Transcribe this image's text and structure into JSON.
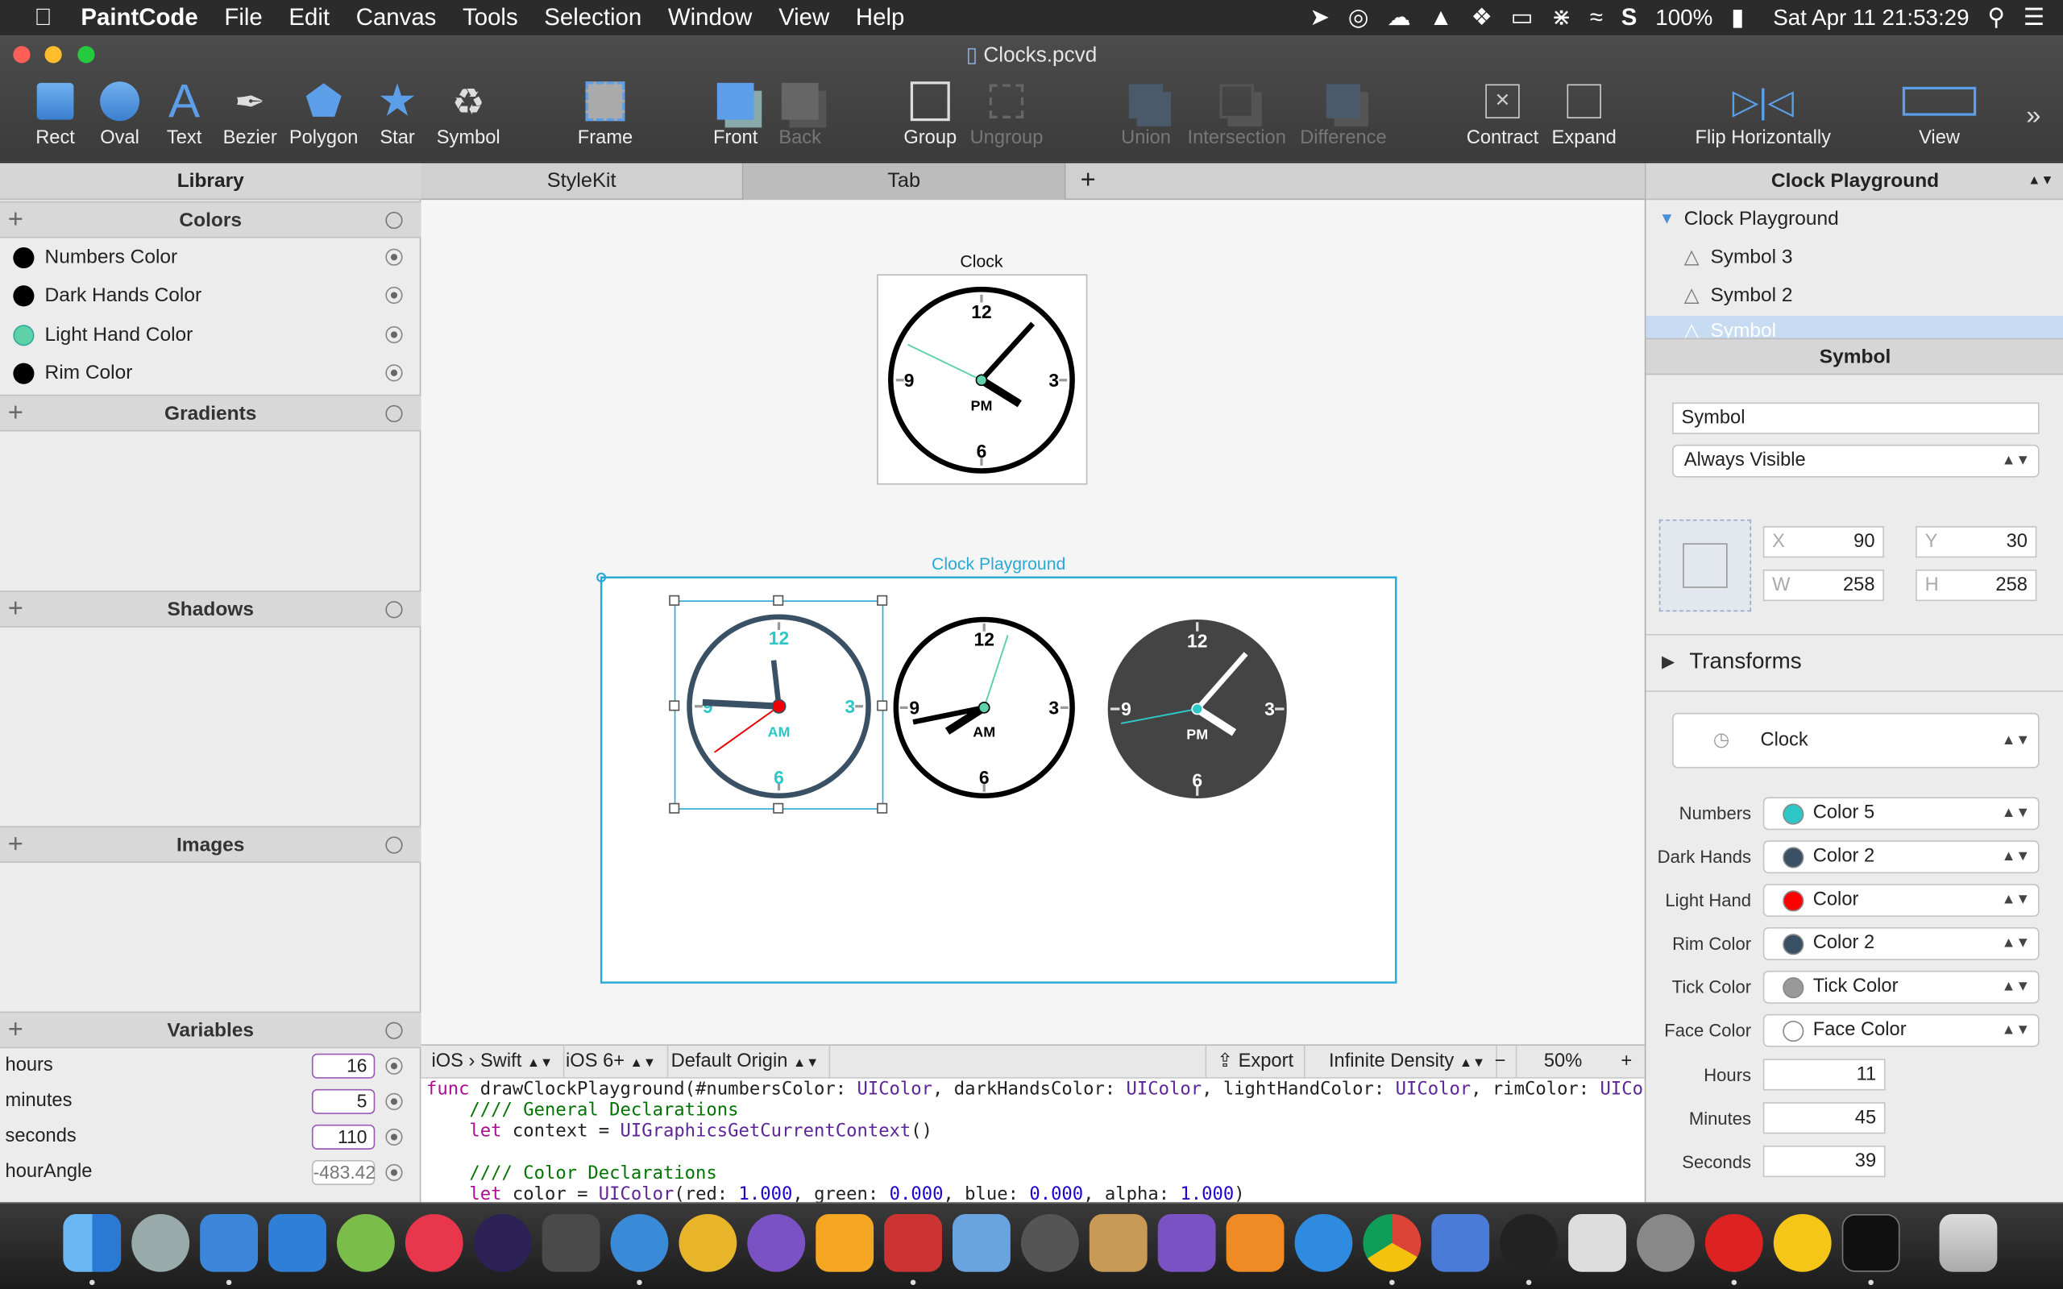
{
  "menubar": {
    "app": "PaintCode",
    "items": [
      "File",
      "Edit",
      "Canvas",
      "Tools",
      "Selection",
      "Window",
      "View",
      "Help"
    ],
    "battery": "100%",
    "clock": "Sat Apr 11  21:53:29"
  },
  "window": {
    "title": "Clocks.pcvd"
  },
  "toolbar": {
    "rect": "Rect",
    "oval": "Oval",
    "text": "Text",
    "bezier": "Bezier",
    "polygon": "Polygon",
    "star": "Star",
    "symbol": "Symbol",
    "frame": "Frame",
    "front": "Front",
    "back": "Back",
    "group": "Group",
    "ungroup": "Ungroup",
    "union": "Union",
    "intersection": "Intersection",
    "difference": "Difference",
    "contract": "Contract",
    "expand": "Expand",
    "flip": "Flip Horizontally",
    "view": "View"
  },
  "library": {
    "title": "Library",
    "colors_header": "Colors",
    "colors": [
      {
        "name": "Numbers Color",
        "swatch": "#000000"
      },
      {
        "name": "Dark Hands Color",
        "swatch": "#000000"
      },
      {
        "name": "Light Hand Color",
        "swatch": "#5fd1a8"
      },
      {
        "name": "Rim Color",
        "swatch": "#000000"
      }
    ],
    "gradients_header": "Gradients",
    "shadows_header": "Shadows",
    "images_header": "Images",
    "variables_header": "Variables",
    "variables": [
      {
        "name": "hours",
        "value": "16"
      },
      {
        "name": "minutes",
        "value": "5"
      },
      {
        "name": "seconds",
        "value": "110"
      },
      {
        "name": "hourAngle",
        "value": "-483.42"
      }
    ]
  },
  "tabs": {
    "stylekit": "StyleKit",
    "tab": "Tab",
    "add": "+"
  },
  "canvas": {
    "clock_label": "Clock",
    "playground_label": "Clock Playground",
    "clocks": [
      {
        "numbers": [
          "12",
          "3",
          "6",
          "9"
        ],
        "ampm": "AM"
      },
      {
        "numbers": [
          "12",
          "3",
          "6",
          "9"
        ],
        "ampm": "AM"
      },
      {
        "numbers": [
          "12",
          "3",
          "6",
          "9"
        ],
        "ampm": "PM"
      }
    ],
    "symbol_clock": {
      "numbers": [
        "12",
        "3",
        "6",
        "9"
      ],
      "ampm": "PM"
    }
  },
  "codebar": {
    "lang": "iOS › Swift",
    "target": "iOS 6+",
    "origin": "Default Origin",
    "export": "Export",
    "density": "Infinite Density",
    "minus": "−",
    "zoom": "50%",
    "plus": "+"
  },
  "code": {
    "l1a": "func ",
    "l1b": "drawClockPlayground(#numbersColor: ",
    "l1c": "UIColor",
    "l1d": ", darkHandsColor: ",
    "l1e": "UIColor",
    "l1f": ", lightHandColor: ",
    "l1g": "UIColor",
    "l1h": ", rimColor: ",
    "l1i": "UICol",
    "l2": "    //// General Declarations",
    "l3a": "    let ",
    "l3b": "context = ",
    "l3c": "UIGraphicsGetCurrentContext",
    "l3d": "()",
    "l5": "    //// Color Declarations",
    "l6a": "    let ",
    "l6b": "color = ",
    "l6c": "UIColor",
    "l6d": "(red: ",
    "l6e": "1.000",
    "l6f": ", green: ",
    "l6g": "0.000",
    "l6h": ", blue: ",
    "l6i": "0.000",
    "l6j": ", alpha: ",
    "l6k": "1.000",
    "l6l": ")"
  },
  "inspector": {
    "header": "Clock Playground",
    "tree": [
      "Clock Playground",
      "Symbol 3",
      "Symbol 2",
      "Symbol"
    ],
    "section": "Symbol",
    "name_value": "Symbol",
    "visibility": "Always Visible",
    "x": "90",
    "y": "30",
    "w": "258",
    "h": "258",
    "x_key": "X",
    "y_key": "Y",
    "w_key": "W",
    "h_key": "H",
    "transforms": "Transforms",
    "symbol_select": "Clock",
    "params": [
      {
        "label": "Numbers",
        "value": "Color 5",
        "swatch": "#2dc7c7"
      },
      {
        "label": "Dark Hands",
        "value": "Color 2",
        "swatch": "#3a5064"
      },
      {
        "label": "Light Hand",
        "value": "Color",
        "swatch": "#ff0000"
      },
      {
        "label": "Rim Color",
        "value": "Color 2",
        "swatch": "#3a5064"
      },
      {
        "label": "Tick Color",
        "value": "Tick Color",
        "swatch": "#999999"
      },
      {
        "label": "Face Color",
        "value": "Face Color",
        "swatch": "#ffffff"
      }
    ],
    "hours_label": "Hours",
    "hours": "11",
    "minutes_label": "Minutes",
    "minutes": "45",
    "seconds_label": "Seconds",
    "seconds": "39"
  }
}
